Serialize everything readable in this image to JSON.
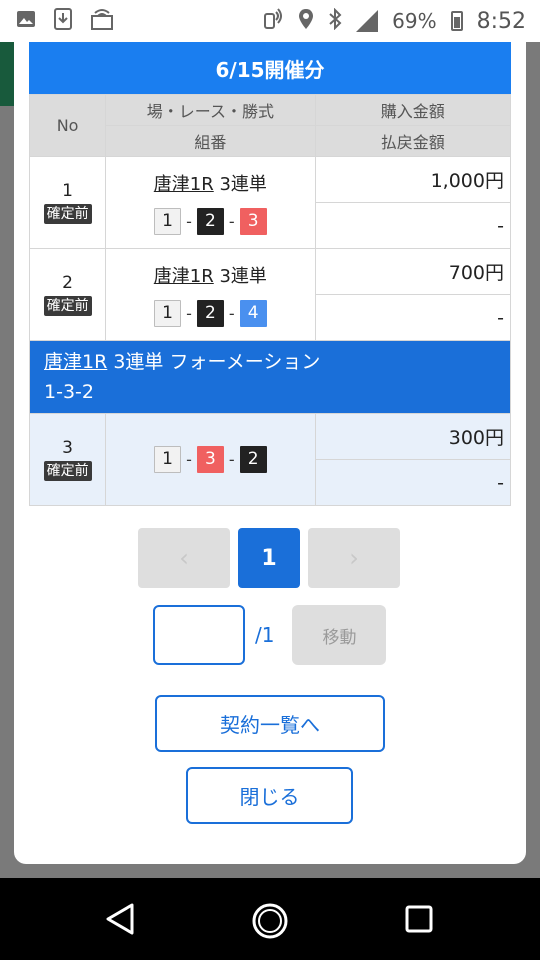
{
  "status_bar": {
    "battery": "69%",
    "time": "8:52",
    "icons": [
      "image-icon",
      "download-icon",
      "cast-icon",
      "nfc-icon",
      "location-icon",
      "bluetooth-icon",
      "signal-icon",
      "battery-icon"
    ]
  },
  "header": {
    "title": "6/15開催分"
  },
  "table": {
    "col_no": "No",
    "col_race": "場・レース・勝式",
    "col_combo": "組番",
    "col_purchase": "購入金額",
    "col_payout": "払戻金額"
  },
  "rows": [
    {
      "no": "1",
      "status": "確定前",
      "race": "唐津1R",
      "bet_type": "3連単",
      "combo": [
        {
          "n": "1",
          "color": "white"
        },
        {
          "n": "2",
          "color": "black"
        },
        {
          "n": "3",
          "color": "red"
        }
      ],
      "purchase": "1,000円",
      "payout": "-"
    },
    {
      "no": "2",
      "status": "確定前",
      "race": "唐津1R",
      "bet_type": "3連単",
      "combo": [
        {
          "n": "1",
          "color": "white"
        },
        {
          "n": "2",
          "color": "black"
        },
        {
          "n": "4",
          "color": "blue"
        }
      ],
      "purchase": "700円",
      "payout": "-"
    }
  ],
  "formation": {
    "race": "唐津1R",
    "title_rest": " 3連単 フォーメーション",
    "pattern": "1-3-2",
    "no": "3",
    "status": "確定前",
    "combo": [
      {
        "n": "1",
        "color": "white"
      },
      {
        "n": "3",
        "color": "red"
      },
      {
        "n": "2",
        "color": "black"
      }
    ],
    "purchase": "300円",
    "payout": "-"
  },
  "pagination": {
    "prev": "‹",
    "current": "1",
    "next": "›",
    "input_value": "",
    "total": "/1",
    "move": "移動"
  },
  "buttons": {
    "contract_list": "契約一覧へ",
    "close": "閉じる"
  },
  "colors": {
    "primary": "#1a7ef0",
    "formation": "#1a6fd9",
    "red_box": "#f06060",
    "blue_box": "#4a90ef"
  }
}
